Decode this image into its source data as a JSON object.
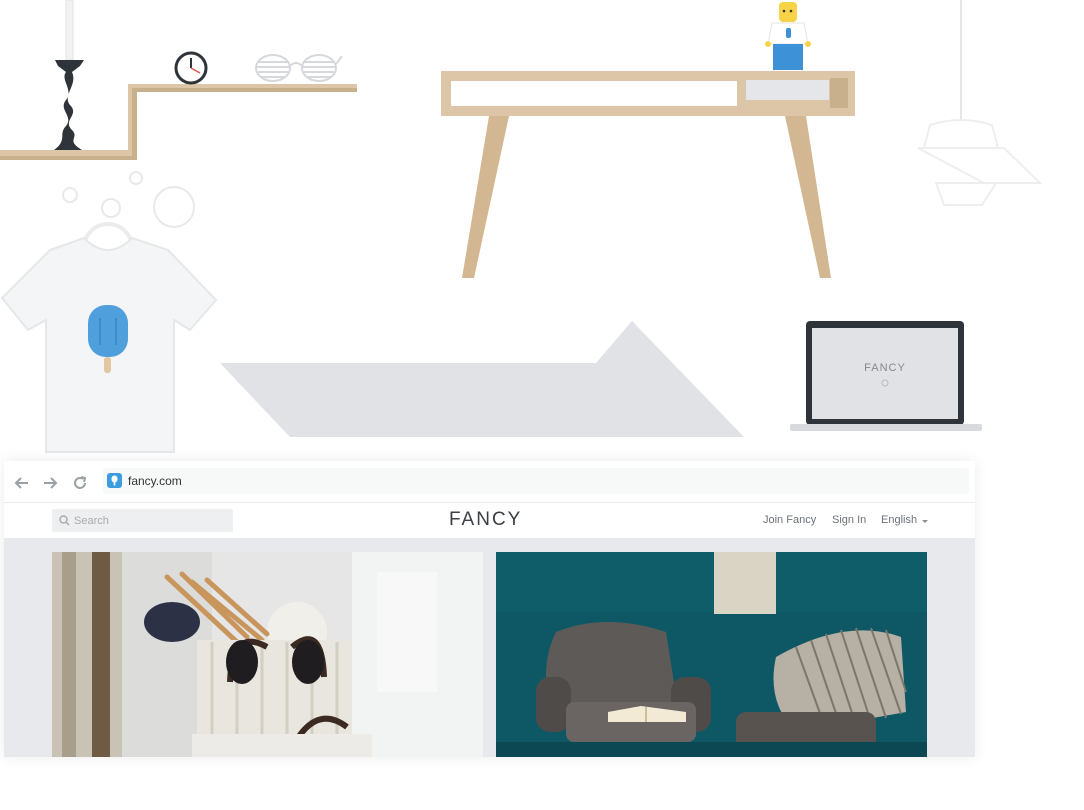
{
  "scene": {
    "laptop_brand": "FANCY"
  },
  "browser": {
    "url": "fancy.com",
    "back_icon": "arrow-left-icon",
    "forward_icon": "arrow-right-icon",
    "reload_icon": "reload-icon",
    "site_icon": "fancy-favicon"
  },
  "site": {
    "logo": "FANCY",
    "search_placeholder": "Search",
    "nav": {
      "join": "Join Fancy",
      "sign_in": "Sign In",
      "language": "English"
    }
  },
  "colors": {
    "accent": "#3b9ce0",
    "feed_background": "#e7e9ec",
    "teal_wall": "#0e5866"
  }
}
